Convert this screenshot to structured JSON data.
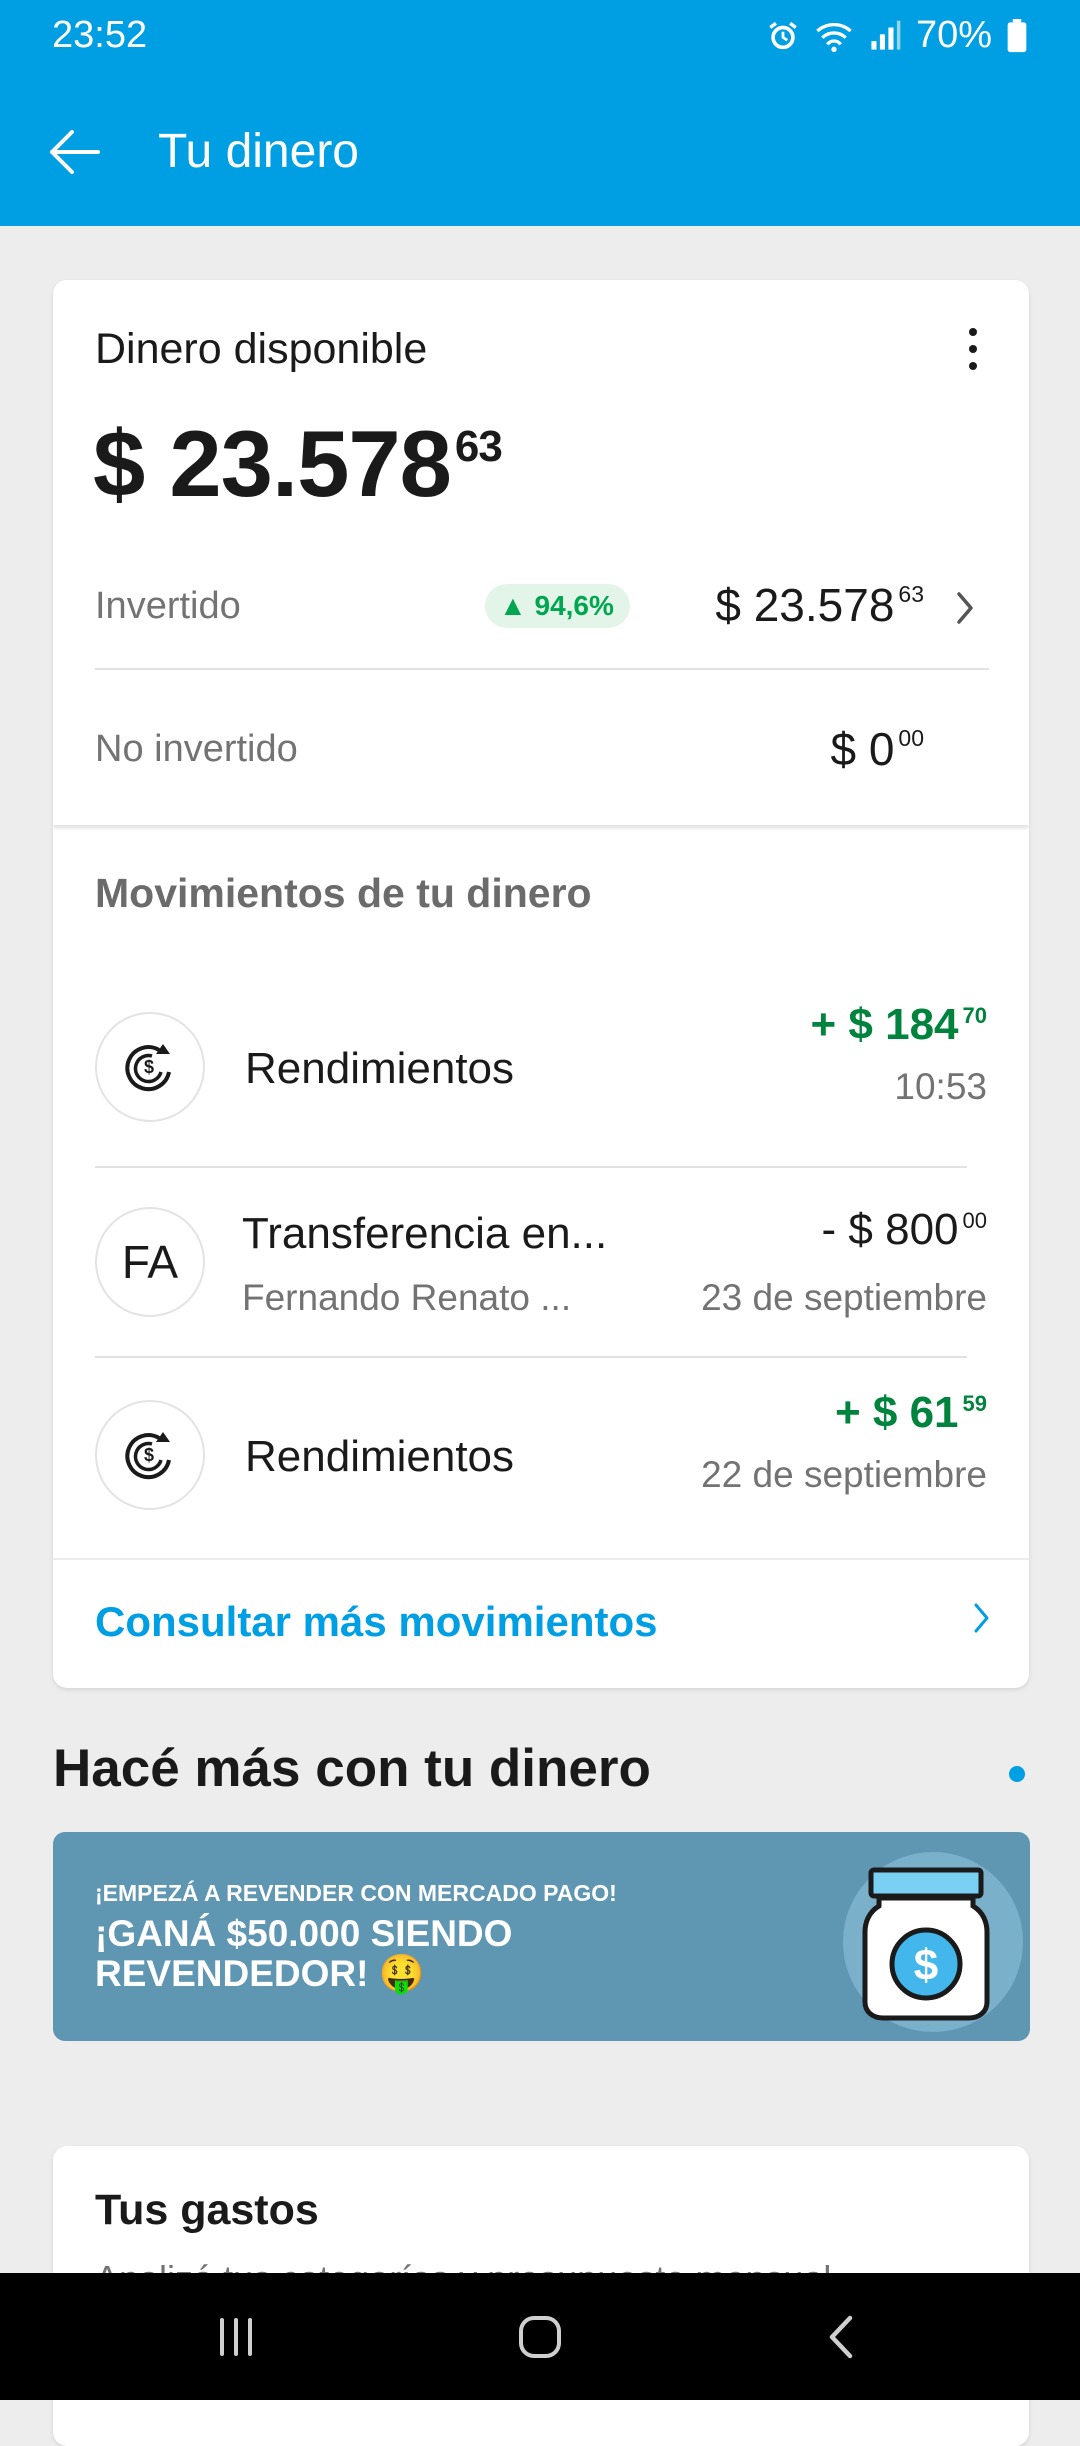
{
  "status_bar": {
    "time": "23:52",
    "battery": "70%"
  },
  "header": {
    "title": "Tu dinero"
  },
  "balance": {
    "label": "Dinero disponible",
    "amount_int": "$ 23.578",
    "amount_cents": "63",
    "invested": {
      "label": "Invertido",
      "badge": "▲ 94,6%",
      "amount_int": "$ 23.578",
      "amount_cents": "63"
    },
    "not_invested": {
      "label": "No invertido",
      "amount_int": "$ 0",
      "amount_cents": "00"
    }
  },
  "movements": {
    "title": "Movimientos de tu dinero",
    "items": [
      {
        "icon": "yield-icon",
        "title": "Rendimientos",
        "subtitle": "",
        "amount_int": "+ $ 184",
        "amount_cents": "70",
        "date": "10:53",
        "positive": true
      },
      {
        "icon": "FA",
        "title": "Transferencia en...",
        "subtitle": "Fernando Renato ...",
        "amount_int": "- $ 800",
        "amount_cents": "00",
        "date": "23 de septiembre",
        "positive": false
      },
      {
        "icon": "yield-icon",
        "title": "Rendimientos",
        "subtitle": "",
        "amount_int": "+ $ 61",
        "amount_cents": "59",
        "date": "22 de septiembre",
        "positive": true
      }
    ],
    "more_label": "Consultar más movimientos"
  },
  "promo": {
    "title": "Hacé más con tu dinero",
    "kicker": "¡EMPEZÁ A REVENDER CON MERCADO PAGO!",
    "headline": "¡GANÁ $50.000 SIENDO REVENDEDOR! 🤑"
  },
  "expenses": {
    "title": "Tus gastos",
    "subtitle": "Analizá tus categorías y presupuesto mensual"
  },
  "colors": {
    "brand": "#009ee3",
    "positive": "#00843d",
    "badge_bg": "#e3f5e9",
    "promo_bg": "#5f96b2"
  }
}
